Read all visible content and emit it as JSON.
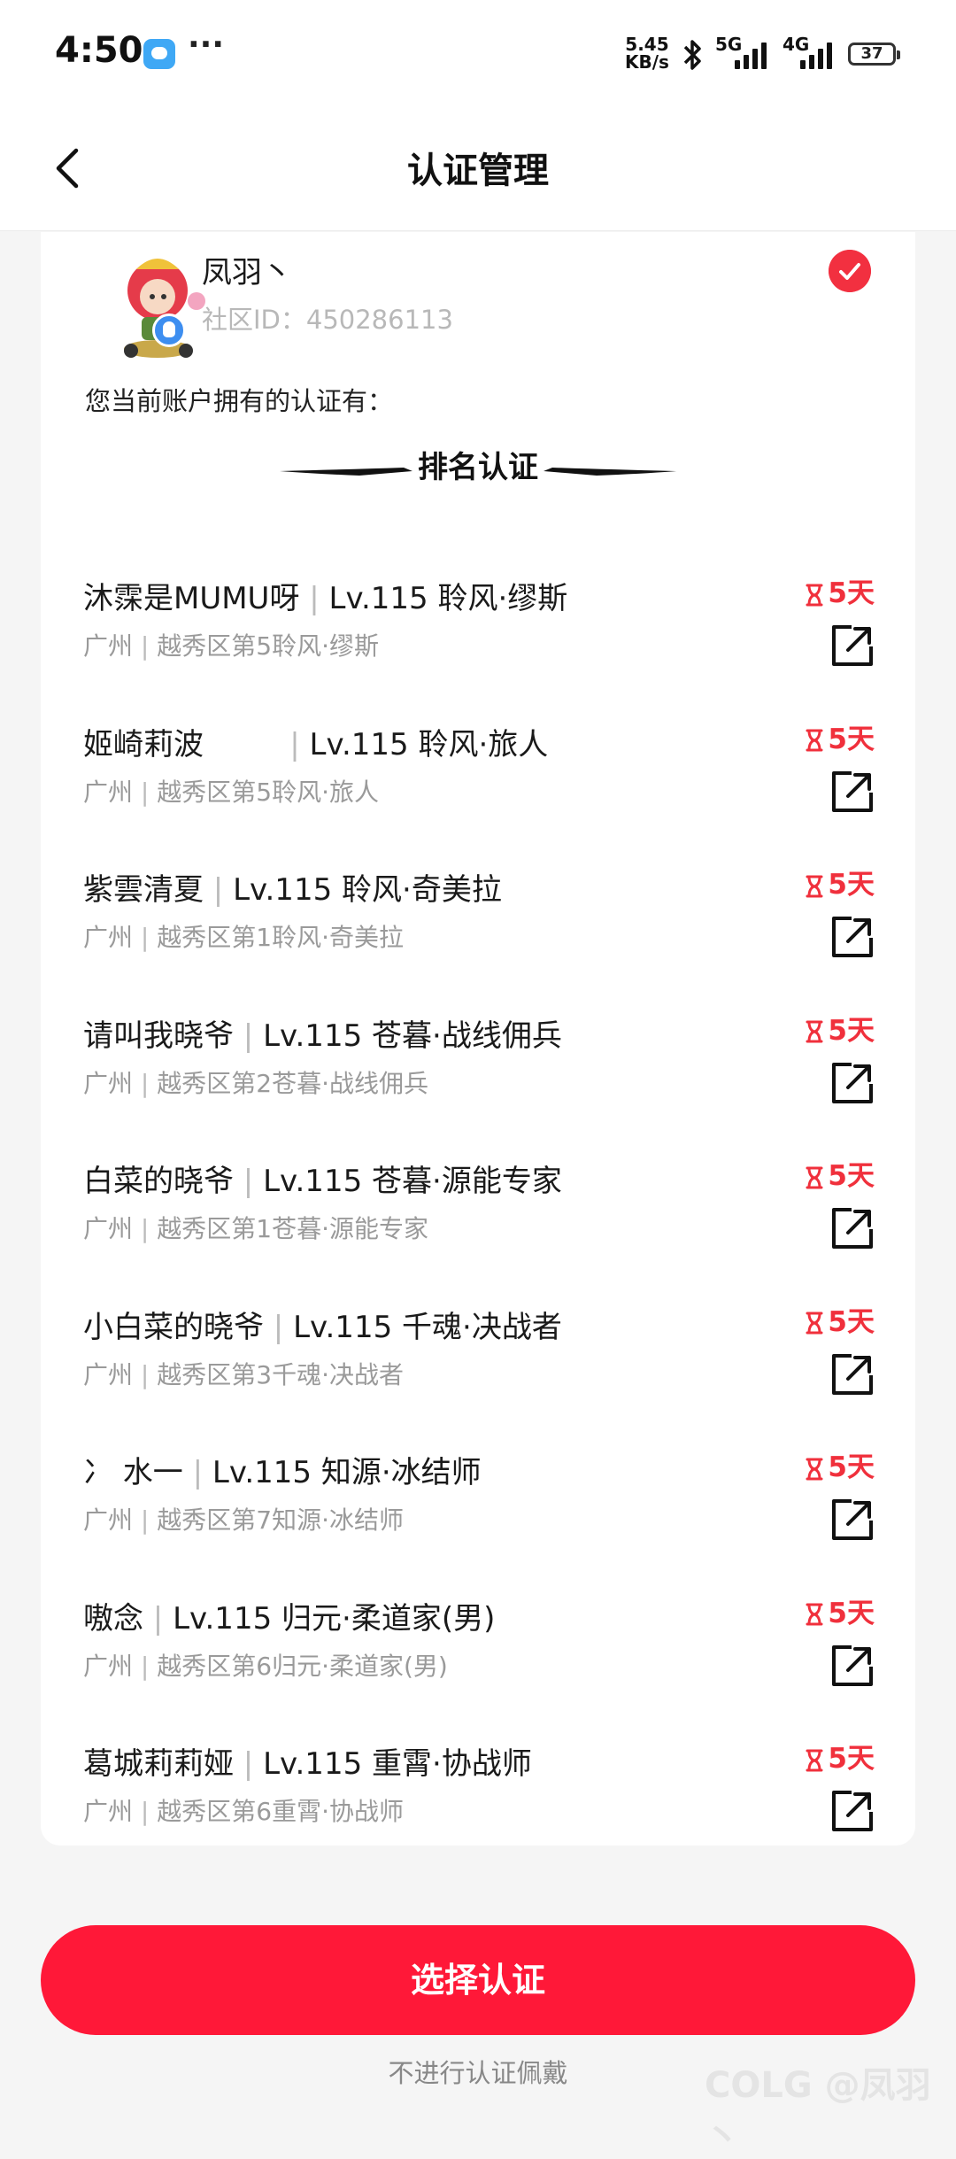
{
  "status_bar": {
    "time": "4:50",
    "more": "···",
    "net_speed": "5.45 KB/s",
    "net_speed_value": "5.45",
    "net_speed_unit": "KB/s",
    "net1": "5G",
    "net2": "4G",
    "battery": "37"
  },
  "header": {
    "title": "认证管理"
  },
  "account": {
    "name": "凤羽丶",
    "community_id": "社区ID：450286113",
    "selected": true
  },
  "intro_text": "您当前账户拥有的认证有：",
  "section_title": "排名认证",
  "certifications": [
    {
      "name": "沐霂是MUMU呀",
      "level": "Lv.115 聆风·缪斯",
      "region": "广州",
      "detail": "越秀区第5聆风·缪斯",
      "days": "5天"
    },
    {
      "name": "姬崎莉波        ",
      "level": "Lv.115 聆风·旅人",
      "region": "广州",
      "detail": "越秀区第5聆风·旅人",
      "days": "5天"
    },
    {
      "name": "紫雲清夏",
      "level": "Lv.115 聆风·奇美拉",
      "region": "广州",
      "detail": "越秀区第1聆风·奇美拉",
      "days": "5天"
    },
    {
      "name": "请叫我晓爷",
      "level": "Lv.115 苍暮·战线佣兵",
      "region": "广州",
      "detail": "越秀区第2苍暮·战线佣兵",
      "days": "5天"
    },
    {
      "name": "白菜的晓爷",
      "level": "Lv.115 苍暮·源能专家",
      "region": "广州",
      "detail": "越秀区第1苍暮·源能专家",
      "days": "5天"
    },
    {
      "name": "小白菜的晓爷",
      "level": "Lv.115 千魂·决战者",
      "region": "广州",
      "detail": "越秀区第3千魂·决战者",
      "days": "5天"
    },
    {
      "name": "冫 水一",
      "level": "Lv.115 知源·冰结师",
      "region": "广州",
      "detail": "越秀区第7知源·冰结师",
      "days": "5天"
    },
    {
      "name": "嗷念",
      "level": "Lv.115 归元·柔道家(男)",
      "region": "广州",
      "detail": "越秀区第6归元·柔道家(男)",
      "days": "5天"
    },
    {
      "name": "葛城莉莉娅",
      "level": "Lv.115 重霄·协战师",
      "region": "广州",
      "detail": "越秀区第6重霄·协战师",
      "days": "5天"
    }
  ],
  "separator": " | ",
  "primary_button": "选择认证",
  "secondary_link": "不进行认证佩戴",
  "watermark": "COLG @凤羽丶",
  "colors": {
    "accent": "#ff1838",
    "days_red": "#f0303c"
  }
}
